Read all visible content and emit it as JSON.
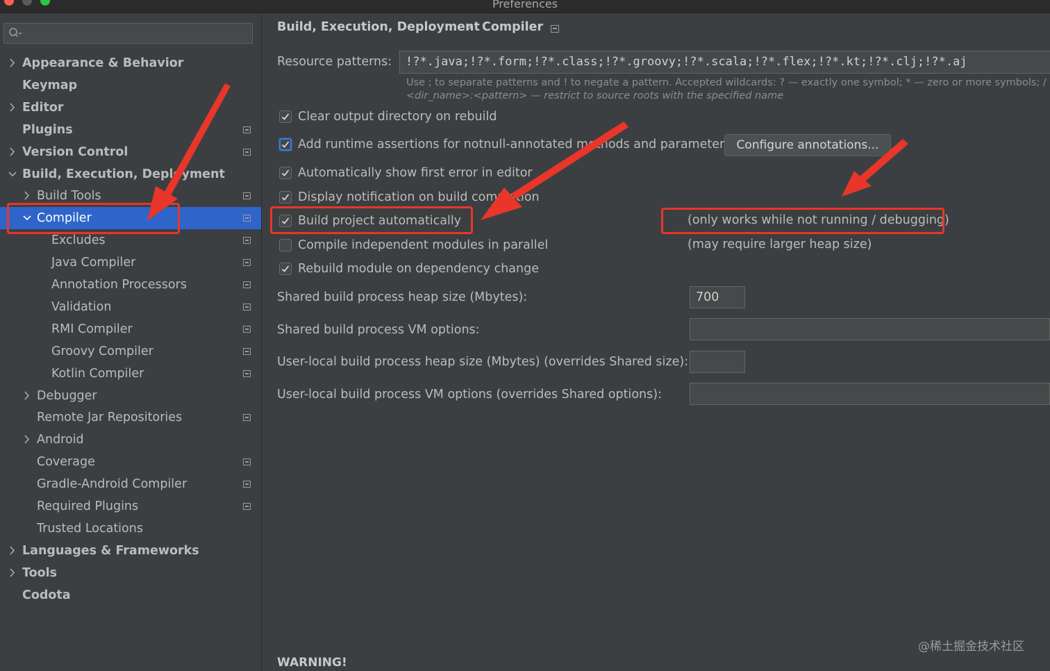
{
  "window": {
    "title": "Preferences"
  },
  "sidebar": {
    "search_placeholder": "",
    "items": [
      {
        "label": "Appearance & Behavior",
        "bold": true,
        "level": 0,
        "chevron": "right",
        "proj": false
      },
      {
        "label": "Keymap",
        "bold": true,
        "level": 0,
        "chevron": "none",
        "proj": false
      },
      {
        "label": "Editor",
        "bold": true,
        "level": 0,
        "chevron": "right",
        "proj": false
      },
      {
        "label": "Plugins",
        "bold": true,
        "level": 0,
        "chevron": "none",
        "proj": true
      },
      {
        "label": "Version Control",
        "bold": true,
        "level": 0,
        "chevron": "right",
        "proj": true
      },
      {
        "label": "Build, Execution, Deployment",
        "bold": true,
        "level": 0,
        "chevron": "down",
        "proj": false
      },
      {
        "label": "Build Tools",
        "bold": false,
        "level": 1,
        "chevron": "right",
        "proj": true
      },
      {
        "label": "Compiler",
        "bold": false,
        "level": 1,
        "chevron": "down",
        "proj": true,
        "selected": true
      },
      {
        "label": "Excludes",
        "bold": false,
        "level": 2,
        "chevron": "none",
        "proj": true
      },
      {
        "label": "Java Compiler",
        "bold": false,
        "level": 2,
        "chevron": "none",
        "proj": true
      },
      {
        "label": "Annotation Processors",
        "bold": false,
        "level": 2,
        "chevron": "none",
        "proj": true
      },
      {
        "label": "Validation",
        "bold": false,
        "level": 2,
        "chevron": "none",
        "proj": true
      },
      {
        "label": "RMI Compiler",
        "bold": false,
        "level": 2,
        "chevron": "none",
        "proj": true
      },
      {
        "label": "Groovy Compiler",
        "bold": false,
        "level": 2,
        "chevron": "none",
        "proj": true
      },
      {
        "label": "Kotlin Compiler",
        "bold": false,
        "level": 2,
        "chevron": "none",
        "proj": true
      },
      {
        "label": "Debugger",
        "bold": false,
        "level": 1,
        "chevron": "right",
        "proj": false
      },
      {
        "label": "Remote Jar Repositories",
        "bold": false,
        "level": 1,
        "chevron": "none",
        "proj": true
      },
      {
        "label": "Android",
        "bold": false,
        "level": 1,
        "chevron": "right",
        "proj": false
      },
      {
        "label": "Coverage",
        "bold": false,
        "level": 1,
        "chevron": "none",
        "proj": true
      },
      {
        "label": "Gradle-Android Compiler",
        "bold": false,
        "level": 1,
        "chevron": "none",
        "proj": true
      },
      {
        "label": "Required Plugins",
        "bold": false,
        "level": 1,
        "chevron": "none",
        "proj": true
      },
      {
        "label": "Trusted Locations",
        "bold": false,
        "level": 1,
        "chevron": "none",
        "proj": false
      },
      {
        "label": "Languages & Frameworks",
        "bold": true,
        "level": 0,
        "chevron": "right",
        "proj": false
      },
      {
        "label": "Tools",
        "bold": true,
        "level": 0,
        "chevron": "right",
        "proj": false
      },
      {
        "label": "Codota",
        "bold": true,
        "level": 0,
        "chevron": "none",
        "proj": false
      }
    ]
  },
  "breadcrumb": {
    "parent": "Build, Execution, Deployment",
    "separator": "›",
    "current": "Compiler"
  },
  "resource_patterns": {
    "label": "Resource patterns:",
    "value": "!?*.java;!?*.form;!?*.class;!?*.groovy;!?*.scala;!?*.flex;!?*.kt;!?*.clj;!?*.aj",
    "hint_line1": "Use ; to separate patterns and ! to negate a pattern. Accepted wildcards: ? — exactly one symbol; * — zero or more symbols; / —",
    "hint_line2": "<dir_name>:<pattern> — restrict to source roots with the specified name"
  },
  "options": {
    "clear_output": {
      "label": "Clear output directory on rebuild",
      "checked": true
    },
    "runtime_assertions": {
      "label": "Add runtime assertions for notnull-annotated methods and parameters",
      "checked": true
    },
    "configure_annotations": "Configure annotations...",
    "show_first_error": {
      "label": "Automatically show first error in editor",
      "checked": true
    },
    "display_notification": {
      "label": "Display notification on build completion",
      "checked": true
    },
    "build_automatically": {
      "label": "Build project automatically",
      "checked": true
    },
    "build_automatically_note": "(only works while not running / debugging)",
    "compile_parallel": {
      "label": "Compile independent modules in parallel",
      "checked": false
    },
    "compile_parallel_note": "(may require larger heap size)",
    "rebuild_dependency": {
      "label": "Rebuild module on dependency change",
      "checked": true
    }
  },
  "heap": {
    "shared_heap_label": "Shared build process heap size (Mbytes):",
    "shared_heap_value": "700",
    "shared_vm_label": "Shared build process VM options:",
    "shared_vm_value": "",
    "user_heap_label": "User-local build process heap size (Mbytes) (overrides Shared size):",
    "user_heap_value": "",
    "user_vm_label": "User-local build process VM options (overrides Shared options):",
    "user_vm_value": ""
  },
  "warning": "WARNING!",
  "watermark": "@稀土掘金技术社区",
  "colors": {
    "selection": "#2f65ca",
    "annotation_red": "#e8362a",
    "background": "#3c3f41"
  }
}
